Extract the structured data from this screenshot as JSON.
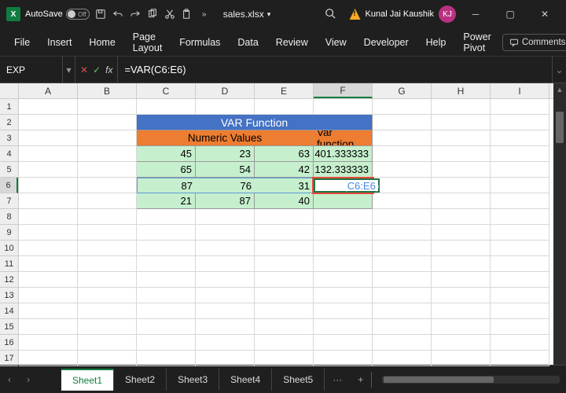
{
  "title": {
    "autosave": "AutoSave",
    "autosave_state": "Off",
    "filename": "sales.xlsx",
    "user_name": "Kunal Jai Kaushik",
    "user_initials": "KJ"
  },
  "ribbon": {
    "tabs": [
      "File",
      "Insert",
      "Home",
      "Page Layout",
      "Formulas",
      "Data",
      "Review",
      "View",
      "Developer",
      "Help",
      "Power Pivot"
    ],
    "comments": "Comments"
  },
  "formula_bar": {
    "name_box": "EXP",
    "formula": "=VAR(C6:E6)"
  },
  "grid": {
    "columns": [
      "A",
      "B",
      "C",
      "D",
      "E",
      "F",
      "G",
      "H",
      "I"
    ],
    "rows": [
      "1",
      "2",
      "3",
      "4",
      "5",
      "6",
      "7",
      "8",
      "9",
      "10",
      "11",
      "12",
      "13",
      "14",
      "15",
      "16",
      "17"
    ],
    "active_col": "F",
    "active_row": "6",
    "title_cell": "VAR Function",
    "num_header": "Numeric Values",
    "var_header": "Var function",
    "data": [
      {
        "c": "45",
        "d": "23",
        "e": "63",
        "f": "401.333333"
      },
      {
        "c": "65",
        "d": "54",
        "e": "42",
        "f": "132.333333"
      },
      {
        "c": "87",
        "d": "76",
        "e": "31",
        "f": ""
      },
      {
        "c": "21",
        "d": "87",
        "e": "40",
        "f": ""
      }
    ],
    "active_formula_prefix": "=VAR(",
    "active_formula_ref": "C6:E6",
    "active_formula_suffix": ")"
  },
  "sheets": {
    "tabs": [
      "Sheet1",
      "Sheet2",
      "Sheet3",
      "Sheet4",
      "Sheet5"
    ],
    "active": "Sheet1"
  }
}
